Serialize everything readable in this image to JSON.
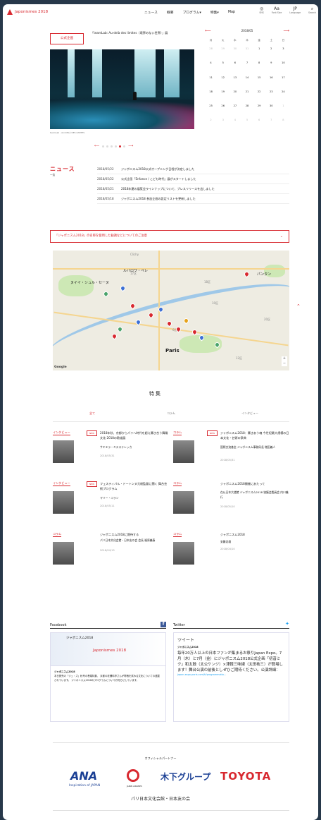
{
  "header": {
    "logo_text": "Japonismes 2018",
    "nav": [
      "ニュース",
      "概要",
      "プログラム▾",
      "特集▾",
      "Map"
    ],
    "tools": [
      {
        "icon": "share-icon",
        "label": "SNS"
      },
      {
        "icon": "font-size-icon",
        "label": "Font Size"
      },
      {
        "icon": "language-icon",
        "label": "Language",
        "value": "JP"
      },
      {
        "icon": "search-icon",
        "label": "Search"
      }
    ]
  },
  "hero": {
    "badge": "公式企画",
    "caption": "「teamLab: Au-delà des limites（境界のない世界）」展",
    "credit": "teamLab - AU-DELÀ DES LIMITES"
  },
  "calendar": {
    "title": "2018/05",
    "weekdays": [
      "月",
      "火",
      "水",
      "木",
      "金",
      "土",
      "日"
    ],
    "weeks": [
      [
        "28",
        "29",
        "30",
        "31",
        "1",
        "2",
        "3"
      ],
      [
        "4",
        "5",
        "6",
        "7",
        "8",
        "9",
        "10"
      ],
      [
        "11",
        "12",
        "13",
        "14",
        "15",
        "16",
        "17"
      ],
      [
        "18",
        "19",
        "20",
        "21",
        "22",
        "23",
        "24"
      ],
      [
        "25",
        "26",
        "27",
        "28",
        "29",
        "30",
        "1"
      ],
      [
        "2",
        "3",
        "4",
        "5",
        "6",
        "7",
        "8"
      ]
    ]
  },
  "news": {
    "title": "ニュース",
    "all_link": "一覧",
    "items": [
      {
        "date": "2018/05/22",
        "text": "ジャポニスム2018公式オープニング日程が決定しました"
      },
      {
        "date": "2018/05/22",
        "text": "公式企画「Enfance / こども時代」展がスタートしました"
      },
      {
        "date": "2018/05/21",
        "text": "2018年夏の展覧会ラインナップについて、プレスリリースを出しました"
      },
      {
        "date": "2018/05/18",
        "text": "ジャポニスム2018 参加企画の設定リストを更新しました"
      }
    ]
  },
  "notice": {
    "text": "「ジャポニスム2018」の名称を使用した勧誘などについてのご注意"
  },
  "map": {
    "legend": [
      {
        "label": "展覧会",
        "color": "#3b6fd4"
      },
      {
        "label": "舞台公演",
        "color": "#d8282f"
      },
      {
        "label": "映像",
        "color": "#e6a21a"
      },
      {
        "label": "生活文化 他",
        "color": "#4aa36b"
      }
    ],
    "genre_select": "ジャンルを選択",
    "google": "Google",
    "labels": [
      "ルバロワ・ペレ",
      "パンタン",
      "ヌイイ・シュル・セーヌ",
      "Paris",
      "17区",
      "18区",
      "10区",
      "20区",
      "12区",
      "6区",
      "Clichy"
    ]
  },
  "features": {
    "title": "特集",
    "tabs": [
      "全て",
      "コラム",
      "インタビュー"
    ],
    "cards": [
      {
        "category": "インタビュー",
        "new": "NEW",
        "headline": "2018年秋、京都からパリへ時代を超え響き合う舞踊文化 2018の歌道展",
        "person": "サキエラ・キスステレッカ",
        "date": "2018/05/31"
      },
      {
        "category": "コラム",
        "new": "NEW",
        "headline": "ジャポニスム2018：響きあう魂 今世紀最大規模の日本文化・芸術の祭典",
        "person": "国際交流基金 ジャポニスム事務局長 増田義人",
        "date": "2018/05/31"
      },
      {
        "category": "インタビュー",
        "new": "NEW",
        "headline": "フェスティバル・ドートンヌ元総監督に聞く 舞台芸術プログラム",
        "person": "マリー・コラン",
        "date": "2018/05/11"
      },
      {
        "category": "コラム",
        "new": "",
        "headline": "ジャポニスム2018開催にあたって",
        "person": "在仏日本大使館 ジャポニスム2018 協議会委員会 内川義行",
        "date": "2018/05/10"
      },
      {
        "category": "コラム",
        "new": "",
        "headline": "ジャポニスム2018に期待する",
        "person": "パリ日本文化会館・日本友の会 会長 福原義春",
        "date": "2018/04/13"
      },
      {
        "category": "コラム",
        "new": "",
        "headline": "ジャポニスム2018",
        "person": "安藤忠雄",
        "date": "2018/04/10"
      }
    ]
  },
  "facebook": {
    "title": "Facebook",
    "page_name": "ジャポニスム2018",
    "logo": "Japonismes 2018",
    "body": "本日発売の「ジュ・ズ」秋号の巻頭特集、 京都の老舗料亭さんが寄稿を試みる文化についての連載されています。 ジャポニスム2018のプログラムについてお知らせしています。"
  },
  "twitter": {
    "title": "Twitter",
    "widget_title": "ツイート",
    "account": "ジャポニスム2018",
    "body": "毎年20万人以上の日本ファンが集まるお祭りJapan Expo。7月（木）と7月（金）にジャポニスム2018公式企画「初音ミク」和太鼓（太公ケンジ）×津軽三味線（太田祐三）が登場します！舞台公演の前後としぜひご期待ください。公演詳細：",
    "link": "japan-expo-paris.com/fr/programmatio..."
  },
  "partners": {
    "title": "オフィシャルパートナー",
    "ana": "ANA",
    "ana_sub": "Inspiration of JAPAN",
    "jal_sub": "JAPAN AIRLINES",
    "kinoshita": "木下グループ",
    "toyota": "TOYOTA"
  },
  "association": "パリ日本文化会館・日本友の会"
}
